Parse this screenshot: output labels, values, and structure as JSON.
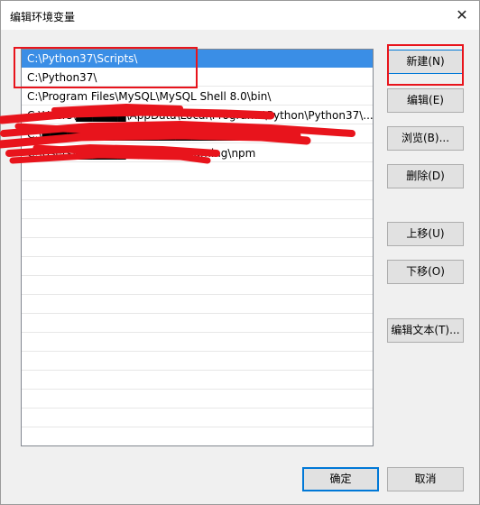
{
  "window": {
    "title": "编辑环境变量",
    "close_glyph": "✕"
  },
  "path_list": [
    {
      "text": "C:\\Python37\\Scripts\\",
      "selected": true
    },
    {
      "text": "C:\\Python37\\",
      "selected": false
    },
    {
      "text": "C:\\Program Files\\MySQL\\MySQL Shell 8.0\\bin\\",
      "selected": false
    },
    {
      "text": "C:\\Users\\██████\\AppData\\Local\\Programs\\Python\\Python37\\...",
      "selected": false
    },
    {
      "text": "C:\\██████████████████████████\\...",
      "selected": false
    },
    {
      "text": "C:\\Users\\██████\\AppData\\Roaming\\npm",
      "selected": false
    },
    {
      "text": "",
      "selected": false
    },
    {
      "text": "",
      "selected": false
    },
    {
      "text": "",
      "selected": false
    },
    {
      "text": "",
      "selected": false
    },
    {
      "text": "",
      "selected": false
    },
    {
      "text": "",
      "selected": false
    },
    {
      "text": "",
      "selected": false
    },
    {
      "text": "",
      "selected": false
    },
    {
      "text": "",
      "selected": false
    },
    {
      "text": "",
      "selected": false
    },
    {
      "text": "",
      "selected": false
    },
    {
      "text": "",
      "selected": false
    },
    {
      "text": "",
      "selected": false
    },
    {
      "text": "",
      "selected": false
    },
    {
      "text": "",
      "selected": false
    },
    {
      "text": "",
      "selected": false
    }
  ],
  "buttons": {
    "new": "新建(N)",
    "edit": "编辑(E)",
    "browse": "浏览(B)...",
    "delete": "删除(D)",
    "move_up": "上移(U)",
    "move_down": "下移(O)",
    "edit_text": "编辑文本(T)...",
    "ok": "确定",
    "cancel": "取消"
  },
  "colors": {
    "selection": "#3a8ee6",
    "annotation_red": "#e8141c",
    "accent_border": "#0078d7"
  }
}
